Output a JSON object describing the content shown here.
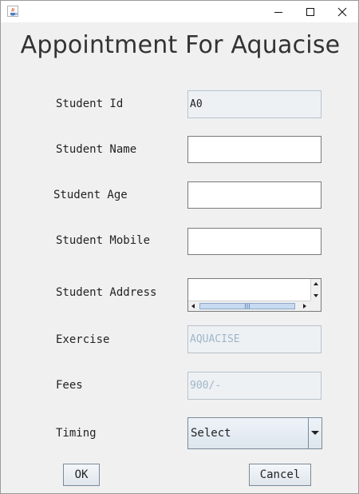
{
  "window": {
    "icons": {
      "app": "java-app-icon",
      "minimize": "minimize-icon",
      "maximize": "maximize-icon",
      "close": "close-icon"
    }
  },
  "title": "Appointment For Aquacise",
  "form": {
    "student_id_label": "Student Id",
    "student_id_value": "A0",
    "student_name_label": "Student Name",
    "student_name_value": "",
    "student_age_label": "Student Age",
    "student_age_value": "",
    "student_mobile_label": "Student Mobile",
    "student_mobile_value": "",
    "student_address_label": "Student Address",
    "student_address_value": "",
    "exercise_label": "Exercise",
    "exercise_value": "AQUACISE",
    "fees_label": "Fees",
    "fees_value": "900/-",
    "timing_label": "Timing",
    "timing_selected": "Select"
  },
  "buttons": {
    "ok_label": "OK",
    "cancel_label": "Cancel"
  }
}
